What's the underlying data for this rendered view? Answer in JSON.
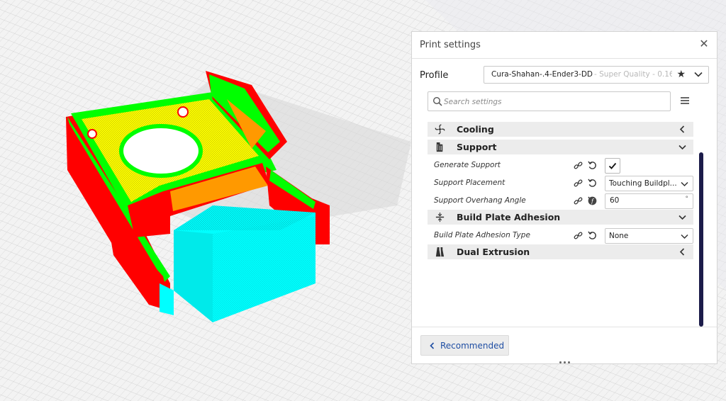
{
  "panel": {
    "title": "Print settings",
    "close_symbol": "✕"
  },
  "profile": {
    "label": "Profile",
    "name": "Cura-Shahan-.4-Ender3-DD",
    "quality": "- Super Quality - 0.16...",
    "favorite_symbol": "★"
  },
  "search": {
    "placeholder": "Search settings",
    "value": ""
  },
  "categories": {
    "cooling": {
      "label": "Cooling",
      "icon": "fan-icon",
      "expanded": false
    },
    "support": {
      "label": "Support",
      "icon": "support-icon",
      "expanded": true
    },
    "adhesion": {
      "label": "Build Plate Adhesion",
      "icon": "adhesion-icon",
      "expanded": true
    },
    "dual": {
      "label": "Dual Extrusion",
      "icon": "dual-extrusion-icon",
      "expanded": false
    }
  },
  "settings": {
    "generate_support": {
      "label": "Generate Support",
      "checked": true
    },
    "support_placement": {
      "label": "Support Placement",
      "value": "Touching Buildpl..."
    },
    "overhang_angle": {
      "label": "Support Overhang Angle",
      "value": "60",
      "unit": "°"
    },
    "adhesion_type": {
      "label": "Build Plate Adhesion Type",
      "value": "None"
    }
  },
  "footer": {
    "recommended_label": "Recommended"
  },
  "colors": {
    "accent": "#1f4ea3",
    "scrollbar": "#1c1c4a",
    "model_wall": "#ff0000",
    "model_infill": "#ffff00",
    "model_skin": "#00ff00",
    "support": "#00ffff",
    "inner_support": "#ff9900"
  }
}
